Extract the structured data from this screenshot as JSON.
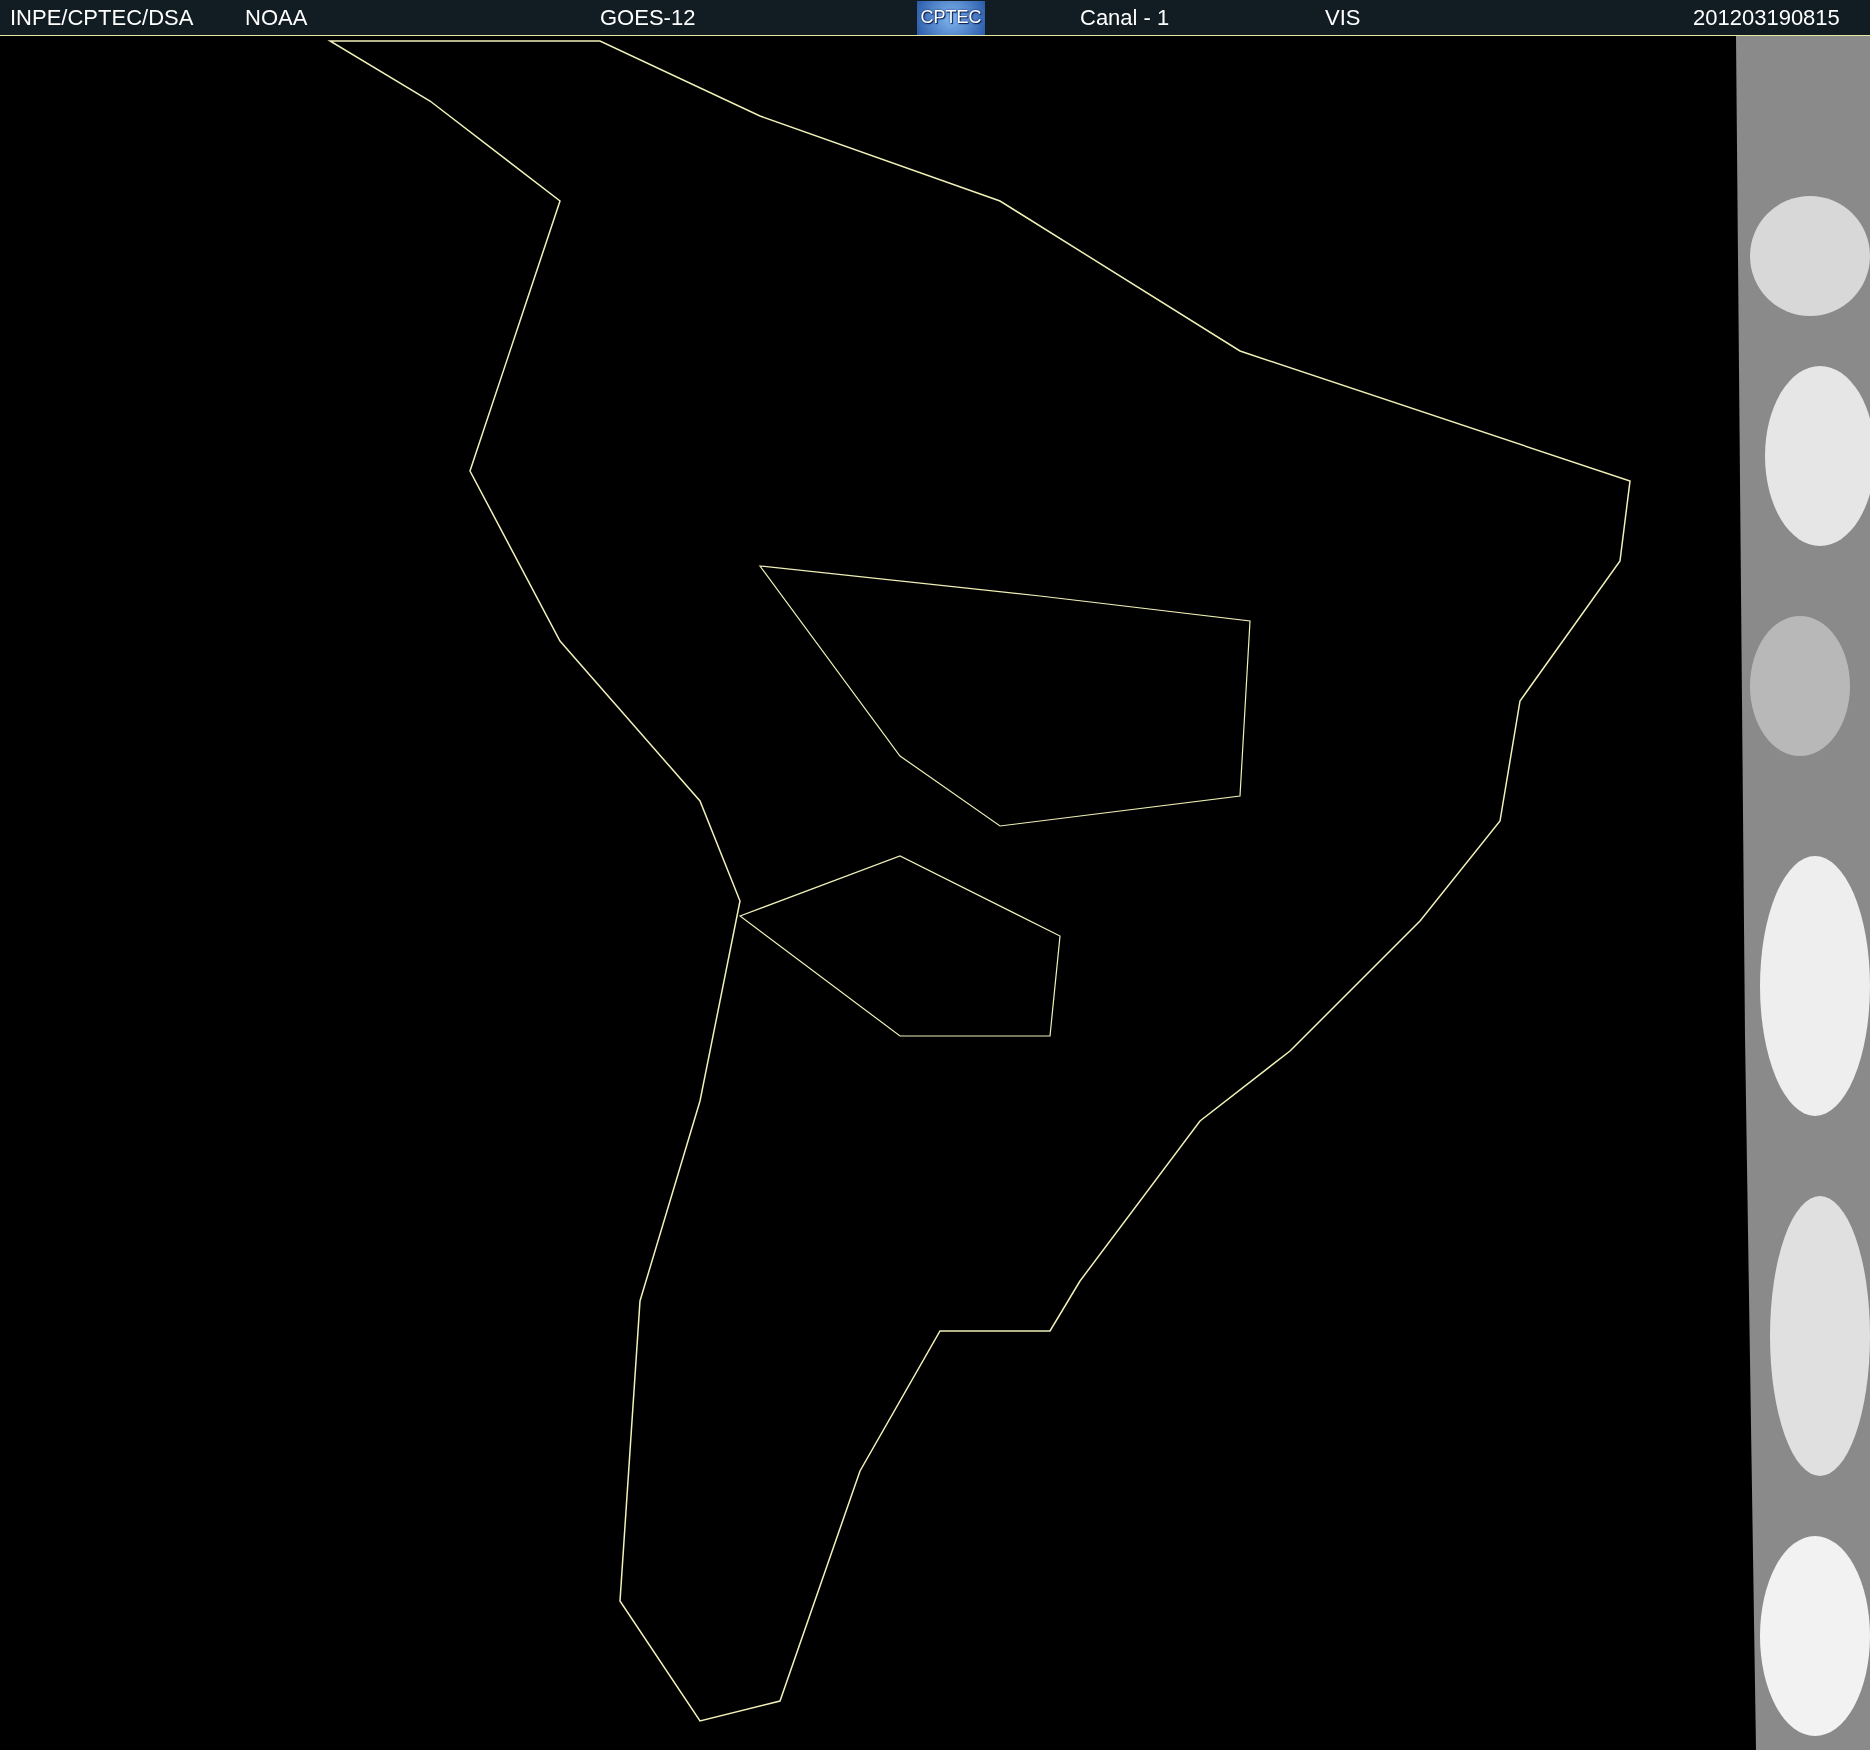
{
  "header": {
    "items": [
      {
        "kind": "text",
        "text": "INPE/CPTEC/DSA"
      },
      {
        "kind": "text",
        "text": "NOAA"
      },
      {
        "kind": "text",
        "text": "GOES-12"
      },
      {
        "kind": "logo",
        "text": "CPTEC"
      },
      {
        "kind": "text",
        "text": "Canal - 1"
      },
      {
        "kind": "text",
        "text": "VIS"
      },
      {
        "kind": "text",
        "text": "201203190815"
      }
    ]
  }
}
